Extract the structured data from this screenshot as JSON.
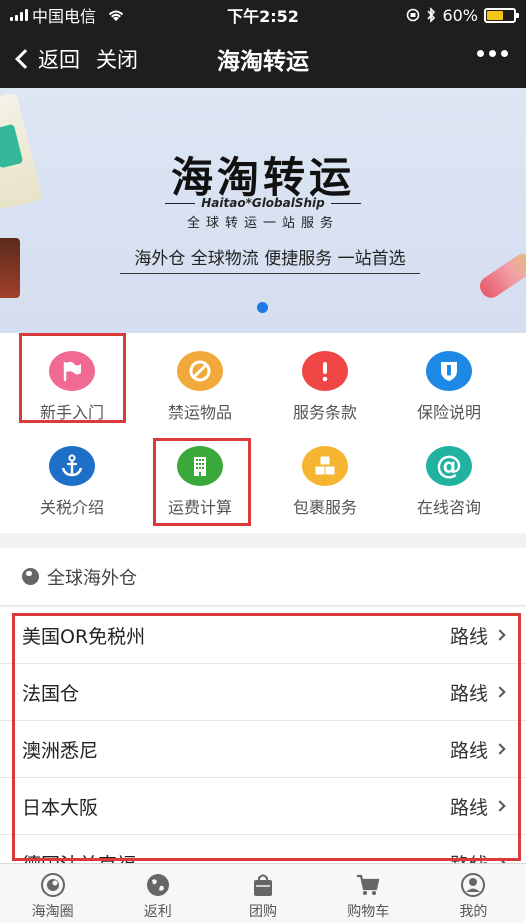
{
  "status_bar": {
    "carrier": "中国电信",
    "time": "下午2:52",
    "battery": "60%",
    "battery_level": 0.6
  },
  "nav": {
    "back_label": "返回",
    "close_label": "关闭",
    "title": "海淘转运"
  },
  "banner": {
    "title": "海淘转运",
    "subtitle_en": "Haitao*GlobalShip",
    "subtitle_cn": "全球转运一站服务",
    "slogan": "海外仓 全球物流 便捷服务 一站首选",
    "accent": "#1e78e6"
  },
  "grid": {
    "items": [
      {
        "label": "新手入门",
        "icon": "flag-icon",
        "color": "#f06a92"
      },
      {
        "label": "禁运物品",
        "icon": "prohibited-icon",
        "color": "#f2a93b"
      },
      {
        "label": "服务条款",
        "icon": "exclamation-icon",
        "color": "#f04545"
      },
      {
        "label": "保险说明",
        "icon": "shield-icon",
        "color": "#1e88e5"
      },
      {
        "label": "关税介绍",
        "icon": "anchor-icon",
        "color": "#1e6fc8"
      },
      {
        "label": "运费计算",
        "icon": "building-icon",
        "color": "#3ba83a"
      },
      {
        "label": "包裹服务",
        "icon": "boxes-icon",
        "color": "#f5b531"
      },
      {
        "label": "在线咨询",
        "icon": "at-icon",
        "color": "#21b3a0"
      }
    ]
  },
  "section": {
    "title": "全球海外仓",
    "rows": [
      {
        "name": "美国OR免税州",
        "action": "路线"
      },
      {
        "name": "法国仓",
        "action": "路线"
      },
      {
        "name": "澳洲悉尼",
        "action": "路线"
      },
      {
        "name": "日本大阪",
        "action": "路线"
      },
      {
        "name": "德国法兰克福",
        "action": "路线"
      }
    ]
  },
  "tabs": [
    {
      "label": "海淘圈",
      "icon": "circle-target-icon"
    },
    {
      "label": "返利",
      "icon": "globe-icon"
    },
    {
      "label": "团购",
      "icon": "shopping-bag-icon"
    },
    {
      "label": "购物车",
      "icon": "cart-icon"
    },
    {
      "label": "我的",
      "icon": "user-icon"
    }
  ],
  "highlight_color": "#d93a3a"
}
